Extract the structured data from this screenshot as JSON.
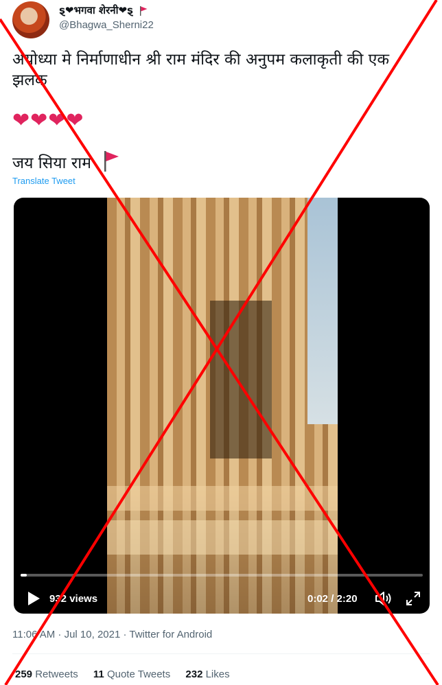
{
  "tweet": {
    "display_name": "ȿ❤भगवा शेरनी❤ȿ",
    "handle": "@Bhagwa_Sherni22",
    "text": "अयोध्या मे निर्माणाधीन श्री  राम मंदिर की अनुपम कलाकृती की एक झलक",
    "hearts": "❤❤❤❤",
    "closing": "जय सिया राम",
    "translate_label": "Translate Tweet",
    "timestamp": "11:06 AM · Jul 10, 2021 · Twitter for Android"
  },
  "video": {
    "views": "932 views",
    "time": "0:02 / 2:20",
    "progress": 0.015
  },
  "stats": {
    "retweets_count": "259",
    "retweets_label": "Retweets",
    "quotes_count": "11",
    "quotes_label": "Quote Tweets",
    "likes_count": "232",
    "likes_label": "Likes"
  },
  "colors": {
    "heart": "#e0245e",
    "link": "#1d9bf0",
    "flag": "#e0245e",
    "cross": "#ff0000"
  },
  "icons": [
    "flag-icon",
    "play-icon",
    "volume-icon",
    "fullscreen-icon"
  ]
}
